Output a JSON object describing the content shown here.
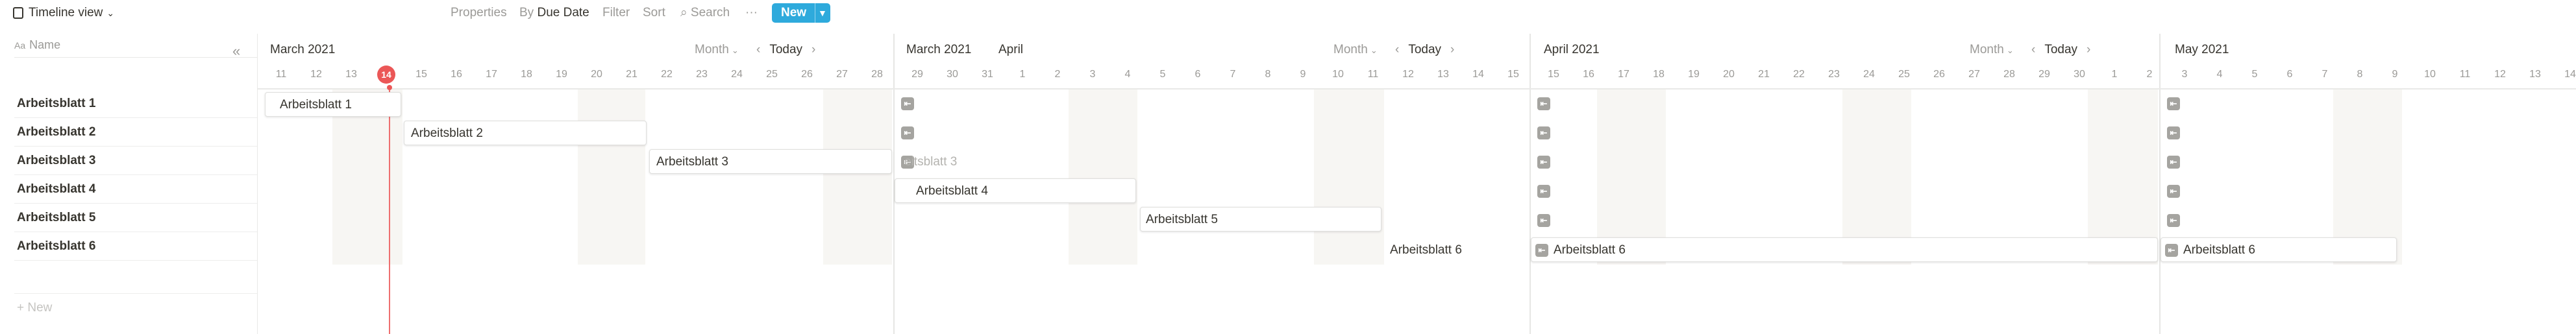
{
  "toolbar": {
    "view_label": "Timeline view",
    "properties": "Properties",
    "by_prefix": "By",
    "due_date": "Due Date",
    "filter": "Filter",
    "sort": "Sort",
    "search": "Search",
    "more": "···",
    "new": "New"
  },
  "sidebar": {
    "collapse_icon": "«",
    "name_header": "Name",
    "new_row": "+ New",
    "rows": [
      "Arbeitsblatt 1",
      "Arbeitsblatt 2",
      "Arbeitsblatt 3",
      "Arbeitsblatt 4",
      "Arbeitsblatt 5",
      "Arbeitsblatt 6"
    ]
  },
  "panels": [
    {
      "month_label": "March 2021",
      "range": "Month",
      "today": "Today",
      "days": [
        "11",
        "12",
        "13",
        "14",
        "15",
        "16",
        "17",
        "18",
        "19",
        "20",
        "21",
        "22",
        "23",
        "24",
        "25",
        "26",
        "27",
        "28"
      ],
      "today_day": "14"
    },
    {
      "month_label": "March 2021",
      "second_label": "April",
      "range": "Month",
      "today": "Today",
      "days": [
        "29",
        "30",
        "31",
        "1",
        "2",
        "3",
        "4",
        "5",
        "6",
        "7",
        "8",
        "9",
        "10",
        "11",
        "12",
        "13",
        "14",
        "15"
      ]
    },
    {
      "month_label": "April 2021",
      "range": "Month",
      "today": "Today",
      "days": [
        "15",
        "16",
        "17",
        "18",
        "19",
        "20",
        "21",
        "22",
        "23",
        "24",
        "25",
        "26",
        "27",
        "28",
        "29",
        "30",
        "1",
        "2"
      ]
    },
    {
      "month_label": "May 2021",
      "range": "Month",
      "today": "Today",
      "days": [
        "3",
        "4",
        "5",
        "6",
        "7",
        "8",
        "9",
        "10",
        "11",
        "12",
        "13",
        "14"
      ]
    }
  ],
  "cards": {
    "p1_r1": "Arbeitsblatt 1",
    "p1_r2": "Arbeitsblatt 2",
    "p1_r3": "Arbeitsblatt 3",
    "p2_r3": "eitsblatt 3",
    "p2_r4": "Arbeitsblatt 4",
    "p2_r5": "Arbeitsblatt 5",
    "p2_r6": "Arbeitsblatt 6",
    "p3_r6": "Arbeitsblatt 6",
    "p4_r6": "Arbeitsblatt 6"
  },
  "colors": {
    "accent": "#2eaadc",
    "today": "#eb5757",
    "weekend": "#f7f6f3"
  }
}
